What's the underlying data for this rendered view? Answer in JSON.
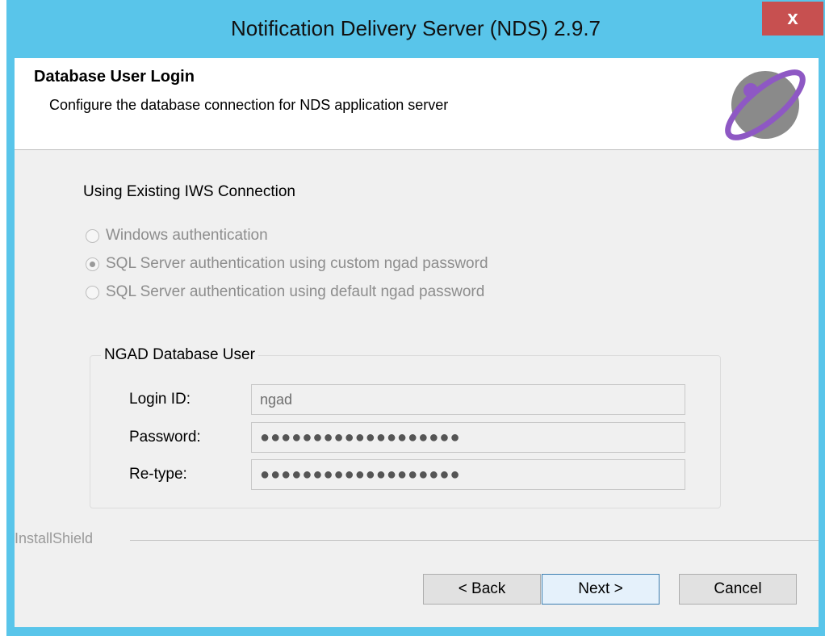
{
  "window": {
    "title": "Notification Delivery Server (NDS) 2.9.7",
    "close_label": "x"
  },
  "header": {
    "title": "Database User Login",
    "subtitle": "Configure the database connection for NDS application server",
    "logo_icon": "globe-orbit-logo"
  },
  "connection": {
    "label": "Using Existing IWS Connection",
    "options": [
      {
        "label": "Windows authentication",
        "selected": false
      },
      {
        "label": "SQL Server authentication using custom ngad password",
        "selected": true
      },
      {
        "label": "SQL Server authentication using default ngad password",
        "selected": false
      }
    ]
  },
  "db_user": {
    "legend": "NGAD Database User",
    "login_label": "Login ID:",
    "login_value": "ngad",
    "password_label": "Password:",
    "password_value": "●●●●●●●●●●●●●●●●●●●",
    "retype_label": "Re-type:",
    "retype_value": "●●●●●●●●●●●●●●●●●●●"
  },
  "footer": {
    "brand": "InstallShield",
    "back_label": "< Back",
    "next_label": "Next >",
    "cancel_label": "Cancel"
  },
  "colors": {
    "titlebar": "#59c5ea",
    "close_button": "#c75050",
    "dialog_bg": "#f0f0f0",
    "default_button_border": "#3c7fb1",
    "logo_purple": "#8e58c4",
    "logo_gray": "#8a8a8a"
  }
}
